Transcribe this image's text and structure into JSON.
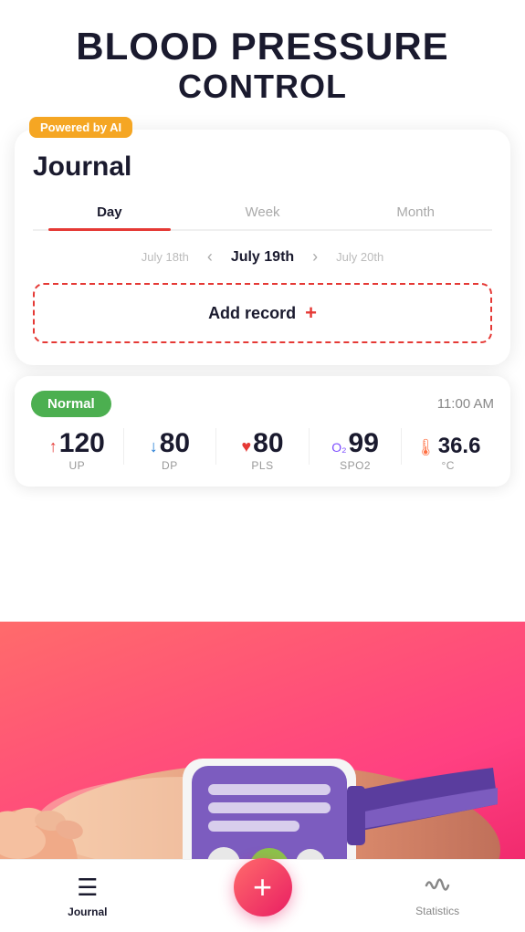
{
  "header": {
    "title_main": "BLOOD PRESSURE",
    "title_sub": "CONTROL"
  },
  "ai_badge": "Powered by AI",
  "journal": {
    "title": "Journal",
    "tabs": [
      {
        "label": "Day",
        "active": true
      },
      {
        "label": "Week",
        "active": false
      },
      {
        "label": "Month",
        "active": false
      }
    ],
    "date_prev": "July 18th",
    "date_current": "July 19th",
    "date_next": "July 20th",
    "add_record_label": "Add record",
    "add_record_plus": "+"
  },
  "record": {
    "status": "Normal",
    "time": "11:00 AM",
    "metrics": [
      {
        "icon": "🔺",
        "value": "120",
        "unit": "UP"
      },
      {
        "icon": "🔻",
        "value": "80",
        "unit": "DP"
      },
      {
        "icon": "❤️",
        "value": "80",
        "unit": "PLS"
      },
      {
        "icon": "🔵",
        "value": "99",
        "unit": "SPO2"
      },
      {
        "icon": "🌡",
        "value": "36.6",
        "unit": "°C"
      }
    ]
  },
  "nav": {
    "items": [
      {
        "icon": "≡",
        "label": "Journal",
        "active": true
      },
      {
        "icon": "+",
        "label": "",
        "active": false,
        "center": true
      },
      {
        "icon": "〜",
        "label": "Statistics",
        "active": false
      }
    ]
  }
}
